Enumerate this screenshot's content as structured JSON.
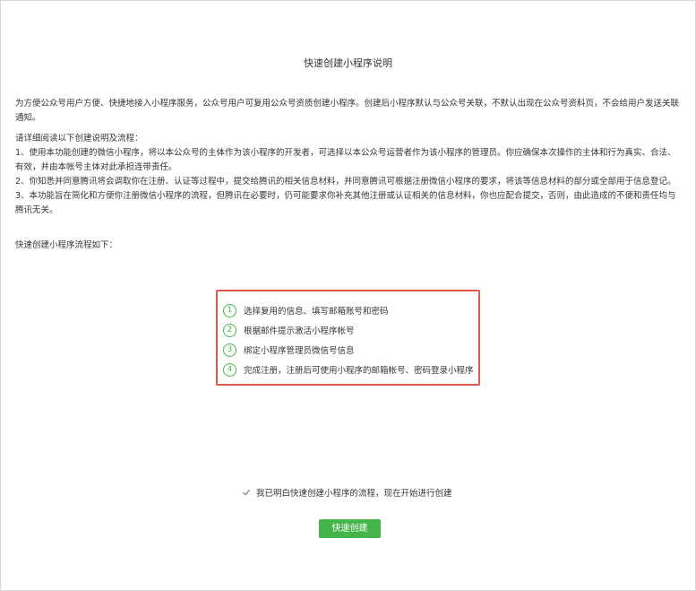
{
  "page": {
    "title": "快速创建小程序说明",
    "intro": "为方便公众号用户方便、快捷地接入小程序服务，公众号用户可复用公众号资质创建小程序。创建后小程序默认与公众号关联，不默认出现在公众号资料页，不会给用户发送关联通知。",
    "rules_heading": "请详细阅读以下创建说明及流程：",
    "rules": [
      "1、使用本功能创建的微信小程序，将以本公众号的主体作为该小程序的开发者，可选择以本公众号运营者作为该小程序的管理员。你应确保本次操作的主体和行为真实、合法、有效，并由本帐号主体对此承担连带责任。",
      "2、你知悉并同意腾讯将会调取你在注册、认证等过程中，提交给腾讯的相关信息材料，并同意腾讯可根据注册微信小程序的要求，将该等信息材料的部分或全部用于信息登记。",
      "3、本功能旨在简化和方便你注册微信小程序的流程，但腾讯在必要时，仍可能要求你补充其他注册或认证相关的信息材料，你也应配合提交，否则，由此造成的不便和责任均与腾讯无关。"
    ],
    "flow_heading": "快速创建小程序流程如下："
  },
  "steps": [
    {
      "num": "1",
      "text": "选择复用的信息、填写邮箱账号和密码"
    },
    {
      "num": "2",
      "text": "根据邮件提示激活小程序帐号"
    },
    {
      "num": "3",
      "text": "绑定小程序管理员微信号信息"
    },
    {
      "num": "4",
      "text": "完成注册，注册后可使用小程序的邮箱帐号、密码登录小程序"
    }
  ],
  "agree": {
    "checked": true,
    "label": "我已明白快速创建小程序的流程，现在开始进行创建"
  },
  "actions": {
    "create_label": "快速创建"
  },
  "colors": {
    "accent_green": "#44b549",
    "highlight_red": "#e0584b"
  }
}
